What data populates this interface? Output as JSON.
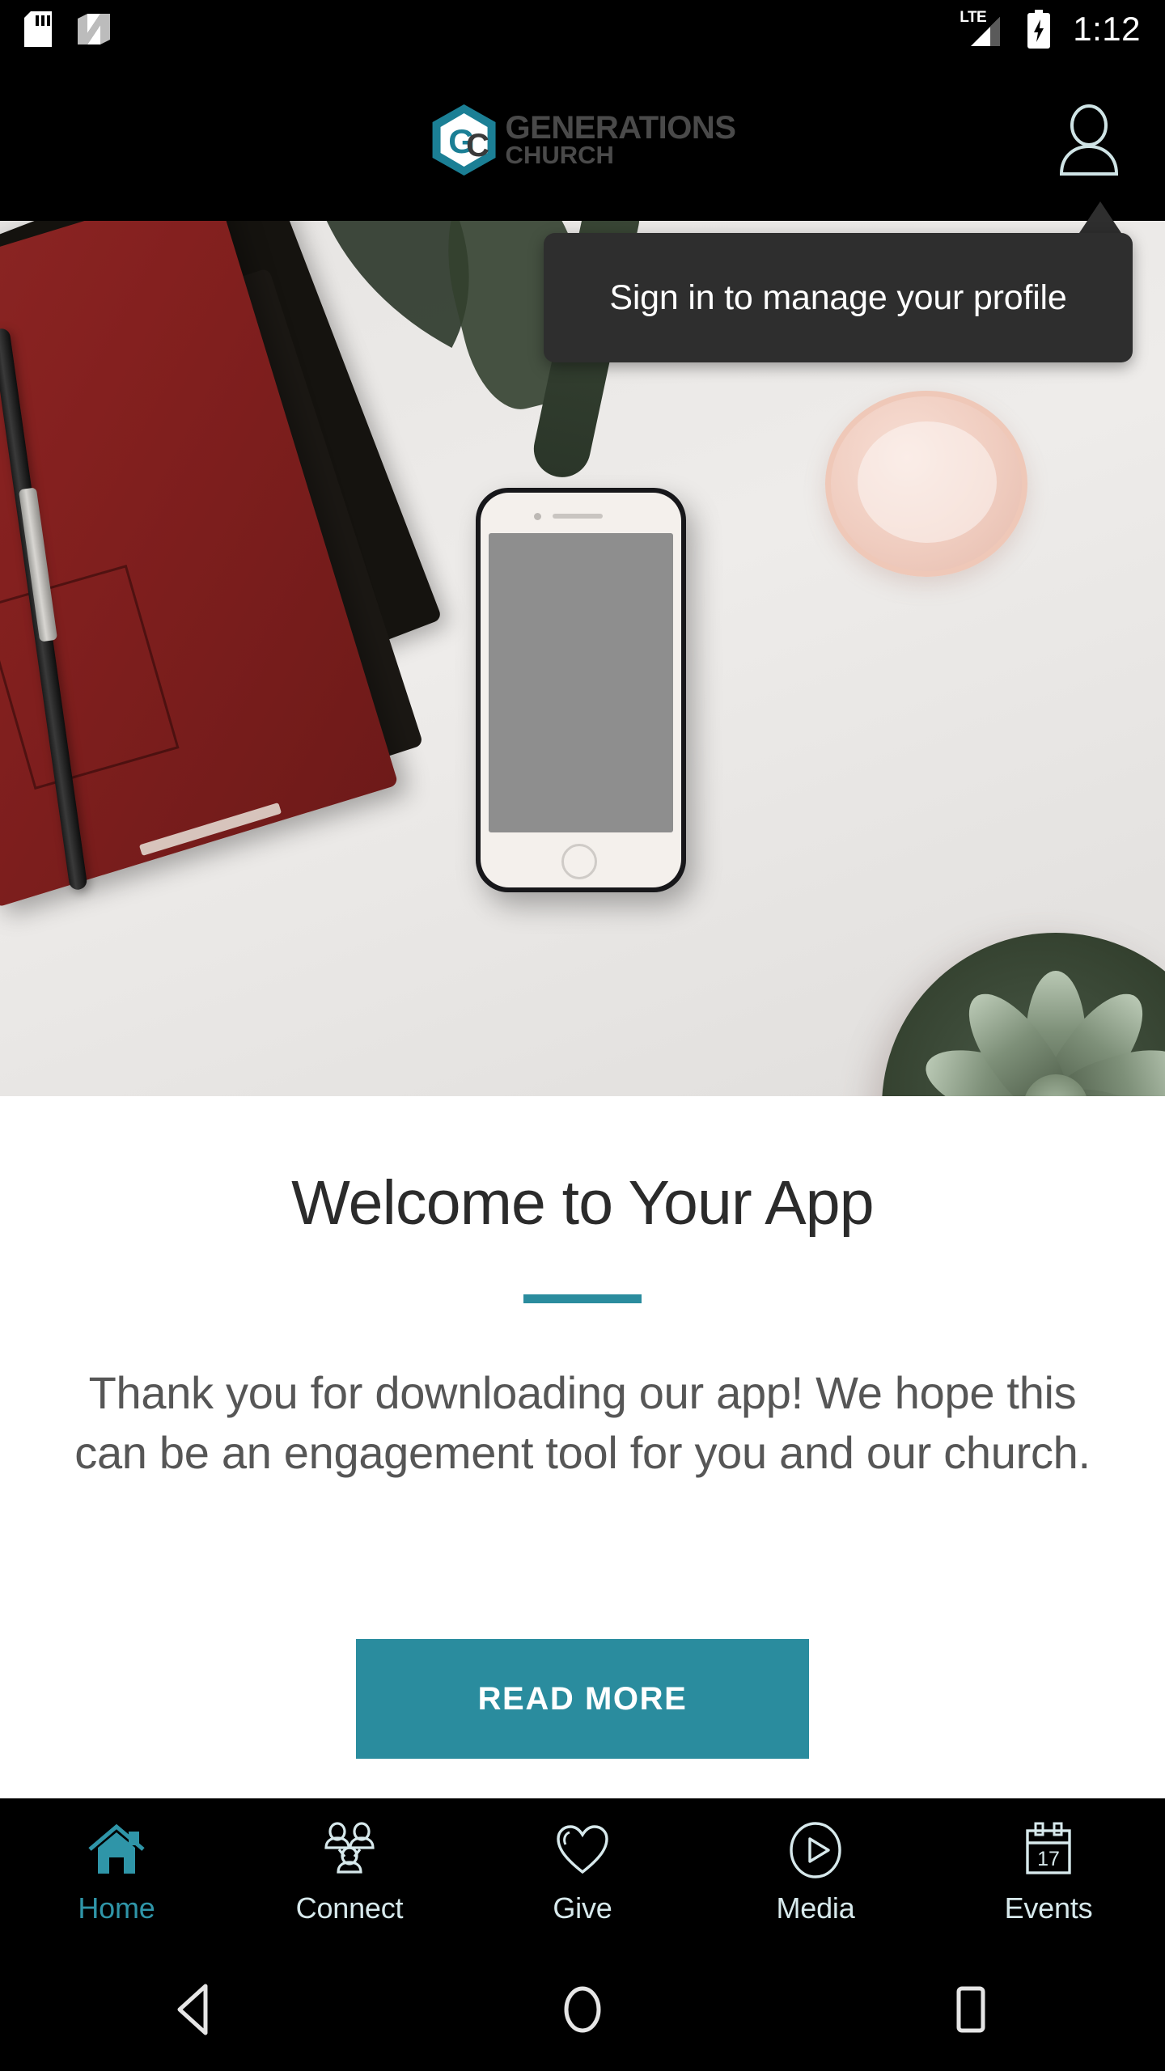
{
  "status_bar": {
    "icons_left": [
      "sd-card-icon",
      "android-nougat-icon"
    ],
    "network": "LTE",
    "signal_icon": "signal-bars-icon",
    "battery_icon": "battery-charging-icon",
    "time": "1:12"
  },
  "header": {
    "logo_line1": "GENERATIONS",
    "logo_line2": "CHURCH",
    "logo_icon": "gc-hexagon-logo",
    "profile_icon": "person-icon"
  },
  "tooltip": {
    "text": "Sign in to manage your profile"
  },
  "hero": {
    "alt": "desk flatlay with red notebook, pen, smartphone, glass and succulent"
  },
  "main": {
    "title": "Welcome to Your App",
    "body": "Thank you for downloading our app! We hope this can be an engagement tool for you and our church.",
    "cta_label": "READ MORE"
  },
  "bottom_nav": {
    "items": [
      {
        "label": "Home",
        "icon": "home-icon",
        "active": true
      },
      {
        "label": "Connect",
        "icon": "people-group-icon",
        "active": false
      },
      {
        "label": "Give",
        "icon": "heart-icon",
        "active": false
      },
      {
        "label": "Media",
        "icon": "play-circle-icon",
        "active": false
      },
      {
        "label": "Events",
        "icon": "calendar-icon",
        "active": false
      }
    ],
    "calendar_day": "17"
  },
  "system_nav": {
    "back": "back-triangle-icon",
    "home": "home-circle-icon",
    "recents": "recents-square-icon"
  },
  "colors": {
    "accent_teal": "#2a8c9e",
    "nav_active": "#2f95a8",
    "tooltip_bg": "#2e2e2e",
    "title_text": "#2b2b2b",
    "body_text": "#565656"
  }
}
